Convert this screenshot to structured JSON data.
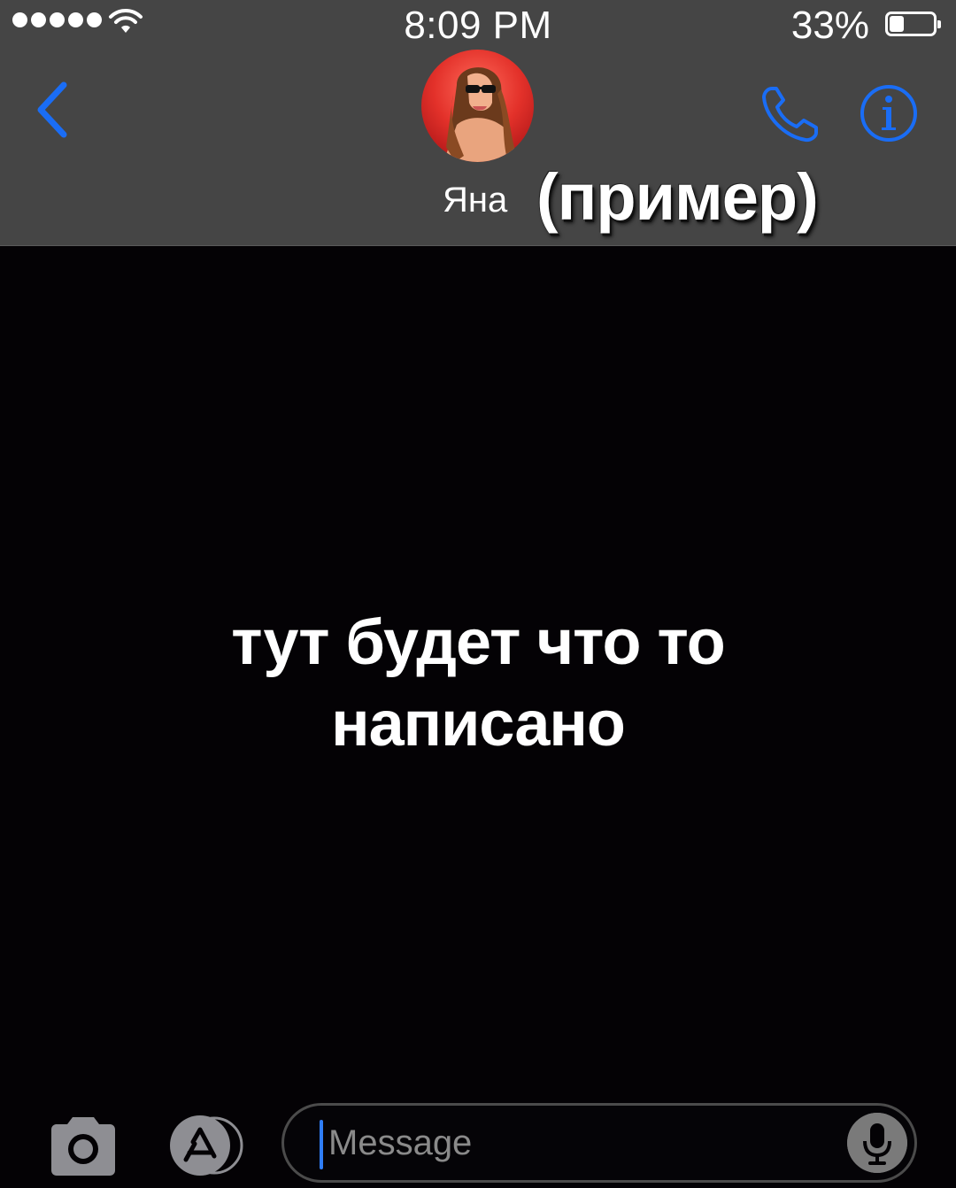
{
  "status_bar": {
    "time": "8:09 PM",
    "battery_percent": "33%",
    "battery_level": 0.33,
    "signal_bars": 5
  },
  "header": {
    "contact_name": "Яна",
    "overlay_label": "(пример)",
    "icons": {
      "back": "chevron-left-icon",
      "call": "phone-icon",
      "info": "info-icon"
    }
  },
  "conversation": {
    "center_text_line1": "тут будет что то",
    "center_text_line2": "написано"
  },
  "composer": {
    "placeholder": "Message",
    "icons": {
      "camera": "camera-icon",
      "apps": "app-store-icon",
      "mic": "microphone-icon"
    }
  },
  "colors": {
    "header_bg": "#454545",
    "accent": "#1a6df5",
    "body_bg": "#040205"
  }
}
